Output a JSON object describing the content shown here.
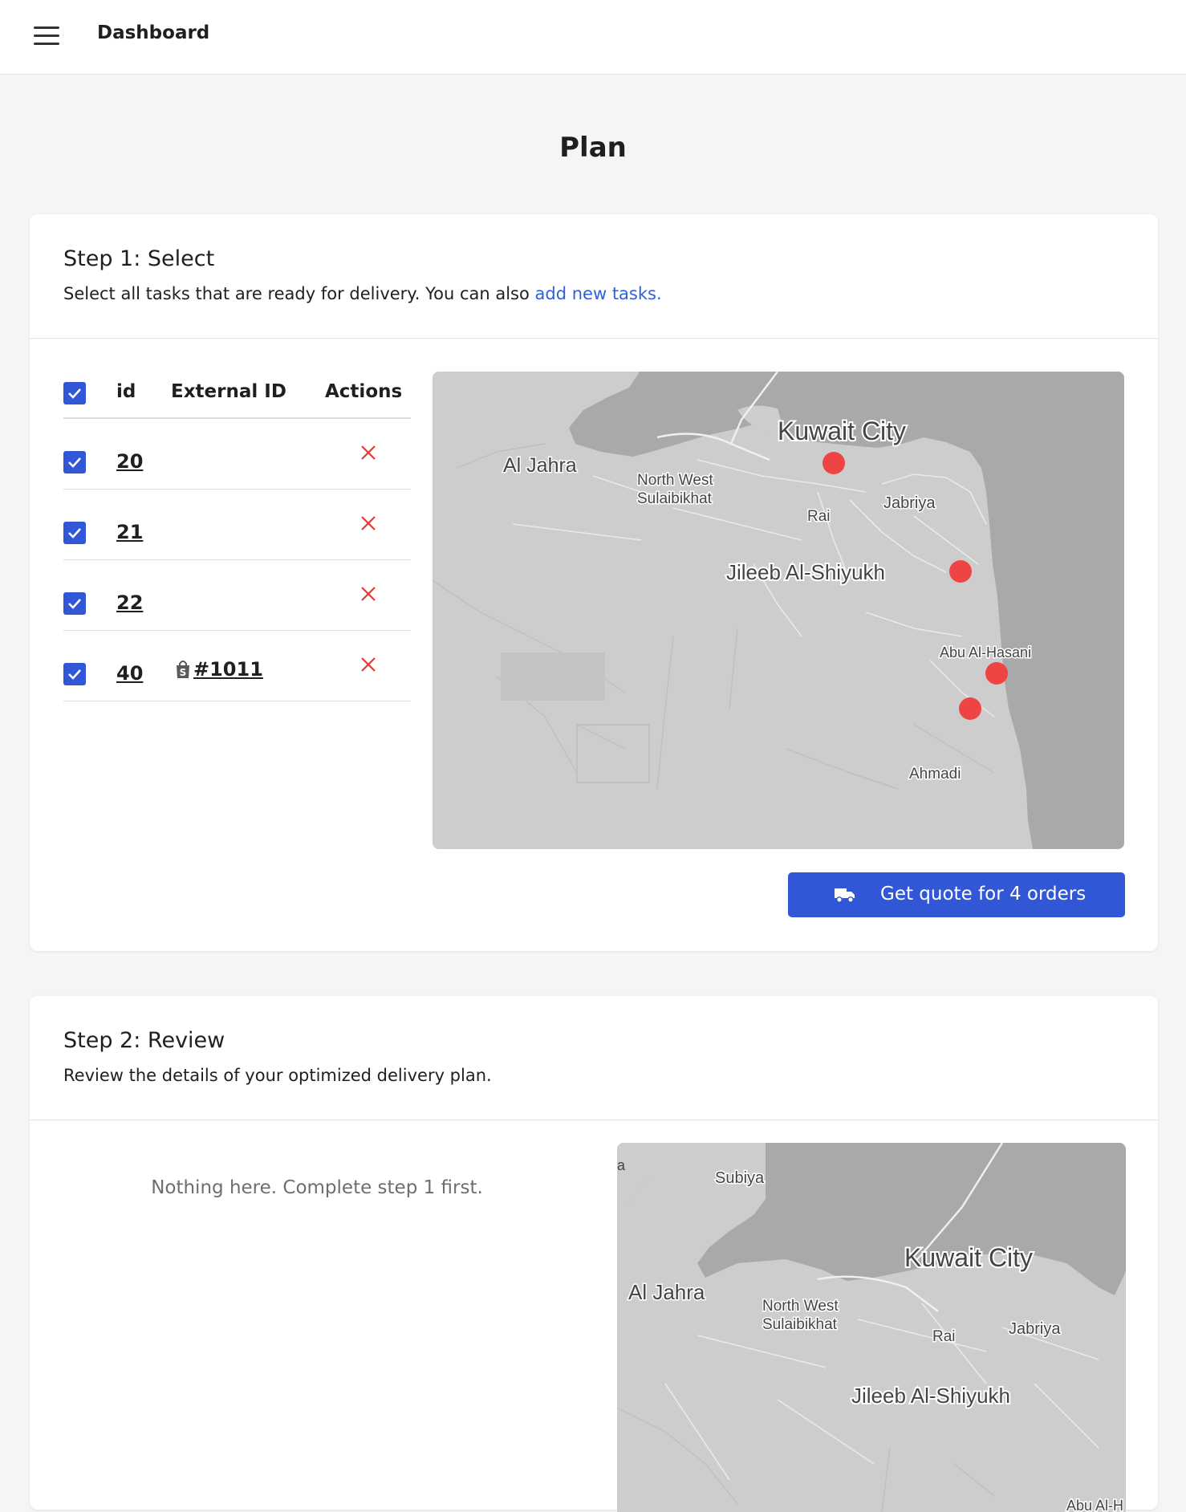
{
  "topbar": {
    "menu_icon": "hamburger-menu-icon",
    "brand": "Dashboard"
  },
  "page": {
    "title": "Plan"
  },
  "step1": {
    "title": "Step 1: Select",
    "desc_prefix": "Select all tasks that are ready for delivery. You can also ",
    "desc_link": "add new tasks.",
    "table": {
      "headers": {
        "id": "id",
        "external_id": "External ID",
        "actions": "Actions"
      },
      "select_all_checked": true,
      "rows": [
        {
          "checked": true,
          "id": "20",
          "external_id": ""
        },
        {
          "checked": true,
          "id": "21",
          "external_id": ""
        },
        {
          "checked": true,
          "id": "22",
          "external_id": ""
        },
        {
          "checked": true,
          "id": "40",
          "external_id": "#1011",
          "external_icon": "shopping-bag-icon"
        }
      ],
      "delete_icon": "close-icon"
    },
    "map": {
      "labels": {
        "kuwait_city": "Kuwait City",
        "al_jahra": "Al Jahra",
        "nw1": "North West",
        "nw2": "Sulaibikhat",
        "rai": "Rai",
        "jabriya": "Jabriya",
        "jileeb": "Jileeb Al-Shiyukh",
        "abu": "Abu Al-Hasani",
        "ahmadi": "Ahmadi"
      },
      "marker_color": "#ee4444"
    },
    "quote_button": {
      "icon": "truck-icon",
      "label": "Get quote for 4 orders"
    }
  },
  "step2": {
    "title": "Step 2: Review",
    "desc": "Review the details of your optimized delivery plan.",
    "empty_message": "Nothing here. Complete step 1 first.",
    "map": {
      "labels": {
        "subiya": "Subiya",
        "kuwait_city": "Kuwait City",
        "al_jahra": "Al Jahra",
        "nw1": "North West",
        "nw2": "Sulaibikhat",
        "rai": "Rai",
        "jabriya": "Jabriya",
        "jileeb": "Jileeb Al-Shiyukh",
        "abu": "Abu Al-H",
        "edge_a": "a"
      }
    }
  },
  "colors": {
    "accent": "#3157d6",
    "link": "#2f5fd9",
    "danger": "#e53935",
    "sea": "#a9a9a9",
    "land": "#cdcdcd"
  }
}
